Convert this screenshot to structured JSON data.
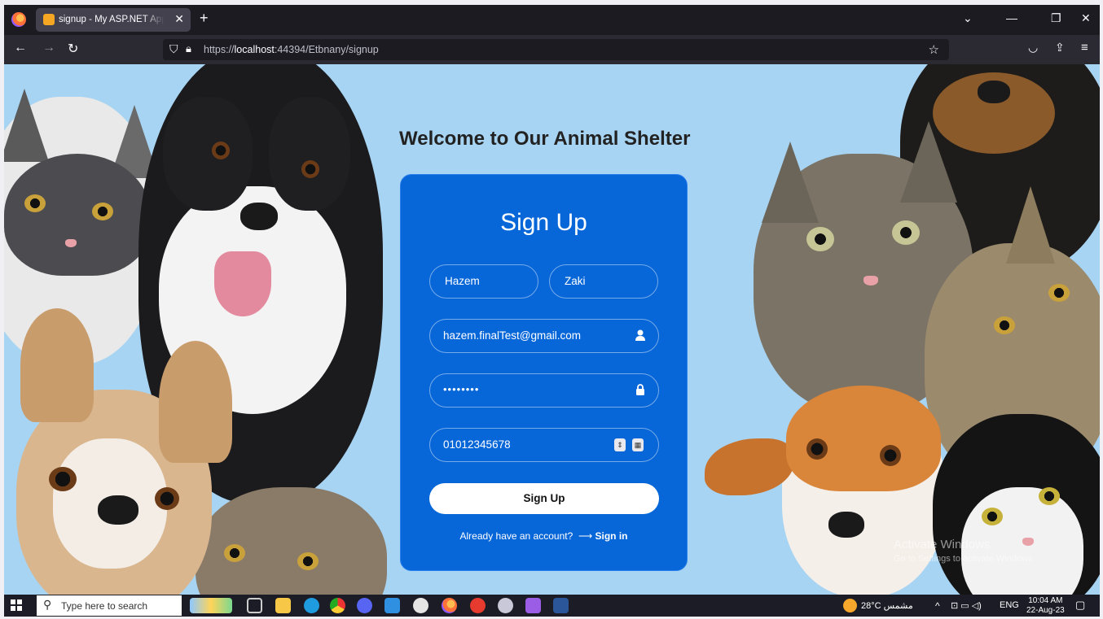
{
  "browser": {
    "tab_title": "signup - My ASP.NET Application",
    "url_prefix": "https://",
    "url_host": "localhost",
    "url_rest": ":44394/Etbnany/signup"
  },
  "page": {
    "heading": "Welcome to Our Animal Shelter",
    "form": {
      "title": "Sign Up",
      "first_name": "Hazem",
      "last_name": "Zaki",
      "email": "hazem.finalTest@gmail.com",
      "password_masked": "••••••••",
      "phone": "01012345678",
      "submit_label": "Sign Up",
      "already_text": "Already have an account?",
      "signin_arrow": "⟶",
      "signin_label": "Sign in"
    },
    "watermark": {
      "line1": "Activate Windows",
      "line2": "Go to Settings to activate Windows."
    }
  },
  "taskbar": {
    "search_placeholder": "Type here to search",
    "weather": "28°C مشمس",
    "language": "ENG",
    "time": "10:04 AM",
    "date": "22-Aug-23"
  },
  "colors": {
    "card": "#0766d8",
    "page_bg": "#a8d4f3",
    "browser_chrome": "#1c1b22"
  }
}
